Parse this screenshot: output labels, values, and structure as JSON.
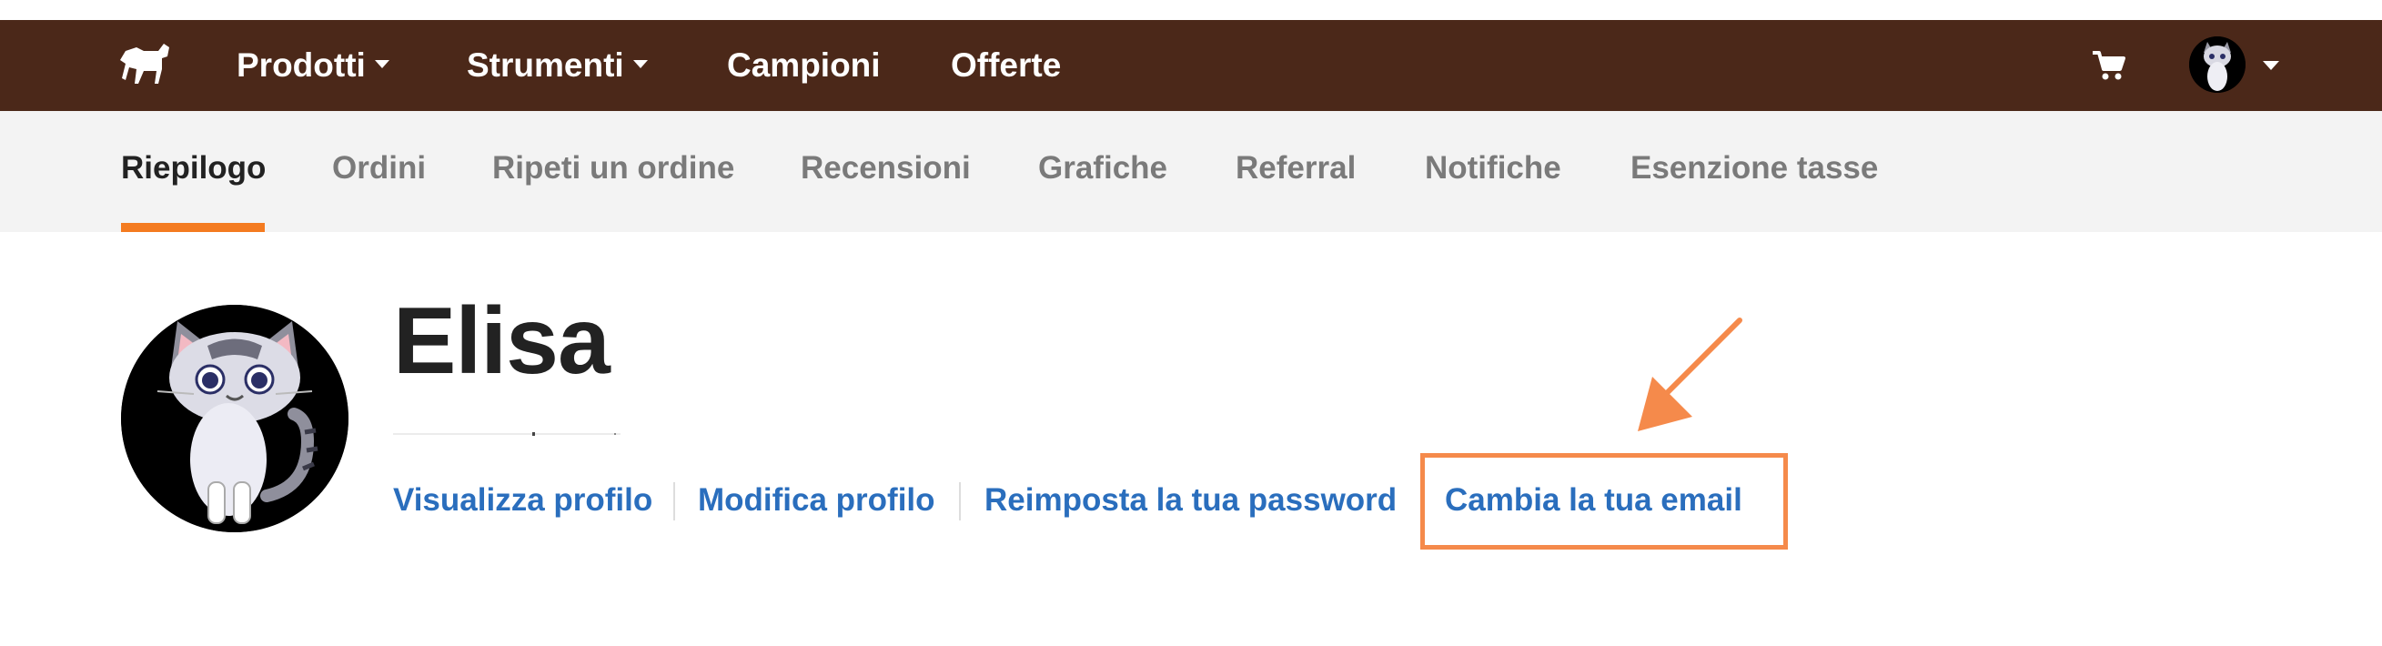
{
  "navbar": {
    "items": [
      {
        "label": "Prodotti",
        "has_dropdown": true
      },
      {
        "label": "Strumenti",
        "has_dropdown": true
      },
      {
        "label": "Campioni",
        "has_dropdown": false
      },
      {
        "label": "Offerte",
        "has_dropdown": false
      }
    ],
    "logo_icon": "horse-logo-icon",
    "cart_icon": "cart-icon",
    "account_icon": "avatar-cat",
    "background_color": "#4b2819"
  },
  "subnav": {
    "tabs": [
      {
        "label": "Riepilogo",
        "active": true
      },
      {
        "label": "Ordini",
        "active": false
      },
      {
        "label": "Ripeti un ordine",
        "active": false
      },
      {
        "label": "Recensioni",
        "active": false
      },
      {
        "label": "Grafiche",
        "active": false
      },
      {
        "label": "Referral",
        "active": false
      },
      {
        "label": "Notifiche",
        "active": false
      },
      {
        "label": "Esenzione tasse",
        "active": false
      }
    ],
    "accent_color": "#f47b20"
  },
  "profile": {
    "name": "Elisa",
    "links": [
      {
        "label": "Visualizza profilo"
      },
      {
        "label": "Modifica profilo"
      },
      {
        "label": "Reimposta la tua password"
      },
      {
        "label": "Cambia la tua email",
        "highlighted": true
      }
    ],
    "link_color": "#2a6ebd",
    "annotation_color": "#f58a4b"
  }
}
